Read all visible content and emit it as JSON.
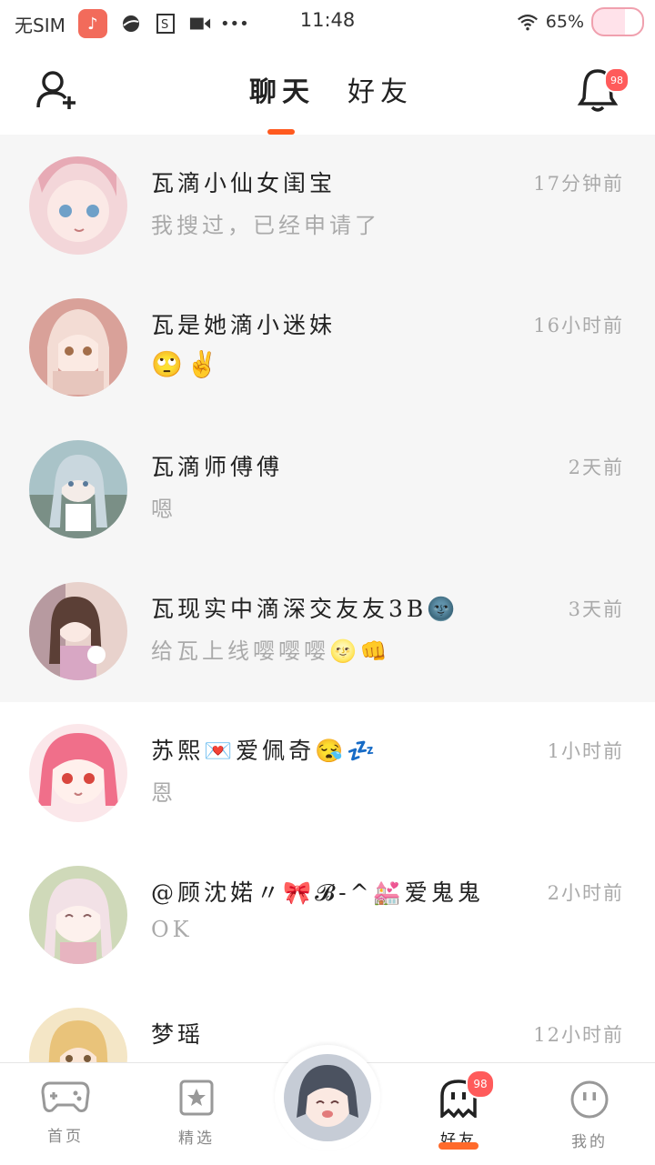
{
  "status_bar": {
    "carrier": "无SIM",
    "time": "11:48",
    "battery": "65%",
    "icons": [
      "music-app-icon",
      "browser-icon",
      "s-icon",
      "video-icon",
      "more-dots-icon",
      "wifi-icon",
      "battery-icon"
    ]
  },
  "header": {
    "tabs": [
      {
        "label": "聊天",
        "active": true
      },
      {
        "label": "好友",
        "active": false
      }
    ],
    "notification_count": "98"
  },
  "chats": [
    {
      "name": "瓦滴小仙女闺宝",
      "preview": "我搜过，已经申请了",
      "time": "17分钟前",
      "pinned": true
    },
    {
      "name": "瓦是她滴小迷妹",
      "preview": "🙄✌",
      "time": "16小时前",
      "pinned": true
    },
    {
      "name": "瓦滴师傅傅",
      "preview": "嗯",
      "time": "2天前",
      "pinned": true
    },
    {
      "name": "瓦现实中滴深交友友3B🌚",
      "preview": "给瓦上线嘤嘤嘤🌝👊",
      "time": "3天前",
      "pinned": true
    },
    {
      "name": "苏熙💌爱佩奇😪💤",
      "preview": "恩",
      "time": "1小时前",
      "pinned": false
    },
    {
      "name": "@顾沈婼〃🎀𝓑-^💒爱鬼鬼",
      "preview": "OK",
      "time": "2小时前",
      "pinned": false
    },
    {
      "name": "梦瑶",
      "preview": "",
      "time": "12小时前",
      "pinned": false
    }
  ],
  "bottom_nav": {
    "items": [
      {
        "label": "首页",
        "icon": "gamepad-icon"
      },
      {
        "label": "精选",
        "icon": "star-bookmark-icon"
      },
      {
        "label": "好友",
        "icon": "ghost-icon",
        "active": true,
        "badge": "98"
      },
      {
        "label": "我的",
        "icon": "face-icon"
      }
    ]
  },
  "colors": {
    "accent": "#ff5a1f",
    "badge": "#ff5b5b",
    "pinned_bg": "#f6f6f6"
  }
}
